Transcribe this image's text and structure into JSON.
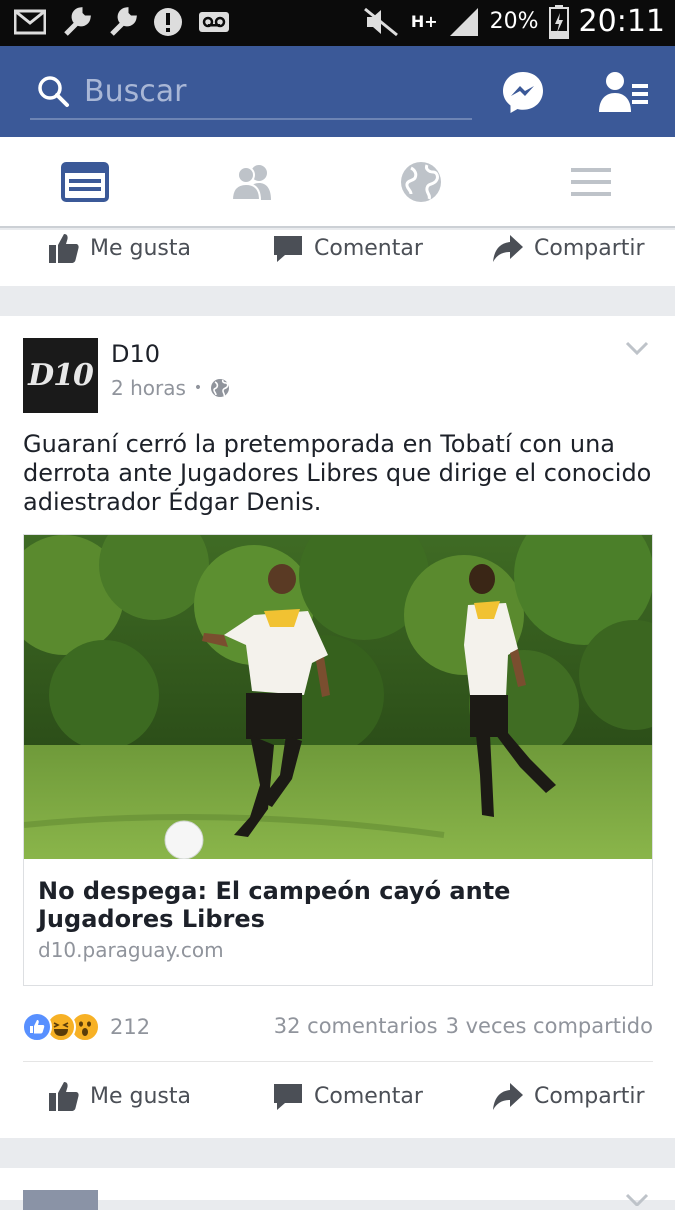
{
  "status_bar": {
    "battery_percent": "20%",
    "time": "20:11",
    "network": "H+"
  },
  "search": {
    "placeholder": "Buscar"
  },
  "icons": {
    "top_bar": [
      "search-icon",
      "messenger-icon",
      "friend-requests-icon"
    ],
    "tabs": [
      "news-feed-icon",
      "friends-icon",
      "notifications-globe-icon",
      "menu-icon"
    ]
  },
  "colors": {
    "brand": "#3b5998",
    "active_tab": "#3b5998",
    "inactive_tab": "#bec3c9",
    "like_blue": "#5890ff",
    "haha_yellow": "#f7b125"
  },
  "previous_post": {
    "actions": {
      "like": "Me gusta",
      "comment": "Comentar",
      "share": "Compartir"
    }
  },
  "post": {
    "avatar_text": "D10",
    "page_name": "D10",
    "time": "2 horas",
    "privacy_separator": "•",
    "text": "Guaraní cerró la pretemporada en Tobatí con una derrota ante Jugadores Libres que dirige el conocido adiestrador Édgar Denis.",
    "link": {
      "title": "No despega: El campeón cayó ante Jugadores Libres",
      "domain": "d10.paraguay.com"
    },
    "reactions_count": "212",
    "comments": "32 comentarios",
    "shares": "3 veces compartido",
    "actions": {
      "like": "Me gusta",
      "comment": "Comentar",
      "share": "Compartir"
    }
  }
}
